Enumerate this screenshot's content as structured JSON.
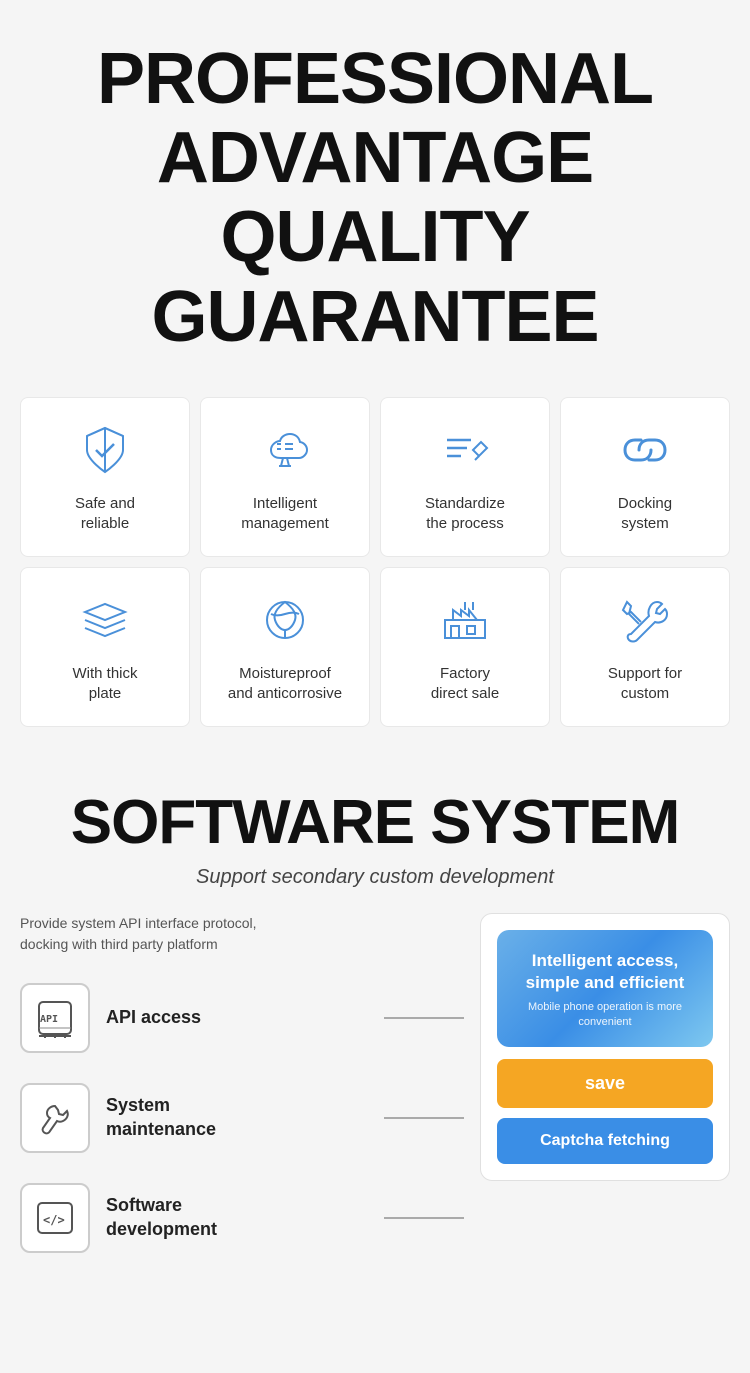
{
  "header": {
    "line1": "PROFESSIONAL",
    "line2": "ADVANTAGE",
    "line3": "QUALITY GUARANTEE"
  },
  "grid": {
    "row1": [
      {
        "id": "safe-reliable",
        "label": "Safe and\nreliable",
        "icon": "shield"
      },
      {
        "id": "intelligent-management",
        "label": "Intelligent\nmanagement",
        "icon": "cloud"
      },
      {
        "id": "standardize-process",
        "label": "Standardize\nthe process",
        "icon": "document-edit"
      },
      {
        "id": "docking-system",
        "label": "Docking\nsystem",
        "icon": "link"
      }
    ],
    "row2": [
      {
        "id": "with-thick-plate",
        "label": "With thick\nplate",
        "icon": "layers"
      },
      {
        "id": "moistureproof",
        "label": "Moistureproof\nand anticorrosive",
        "icon": "leaf"
      },
      {
        "id": "factory-direct",
        "label": "Factory\ndirect sale",
        "icon": "factory"
      },
      {
        "id": "support-custom",
        "label": "Support for\ncustom",
        "icon": "tools"
      }
    ]
  },
  "software": {
    "title": "SOFTWARE SYSTEM",
    "subtitle": "Support secondary custom development",
    "desc": "Provide system API interface protocol,\ndocking with third party platform",
    "items": [
      {
        "id": "api-access",
        "label": "API access",
        "icon": "api"
      },
      {
        "id": "system-maintenance",
        "label": "System\nmaintenance",
        "icon": "wrench"
      },
      {
        "id": "software-development",
        "label": "Software\ndevelopment",
        "icon": "code"
      }
    ],
    "panel": {
      "intelligent_label": "Intelligent access,\nsimple and efficient",
      "mobile_sub": "Mobile phone operation is more\nconvenient",
      "save_btn": "save",
      "captcha_btn": "Captcha fetching"
    }
  }
}
